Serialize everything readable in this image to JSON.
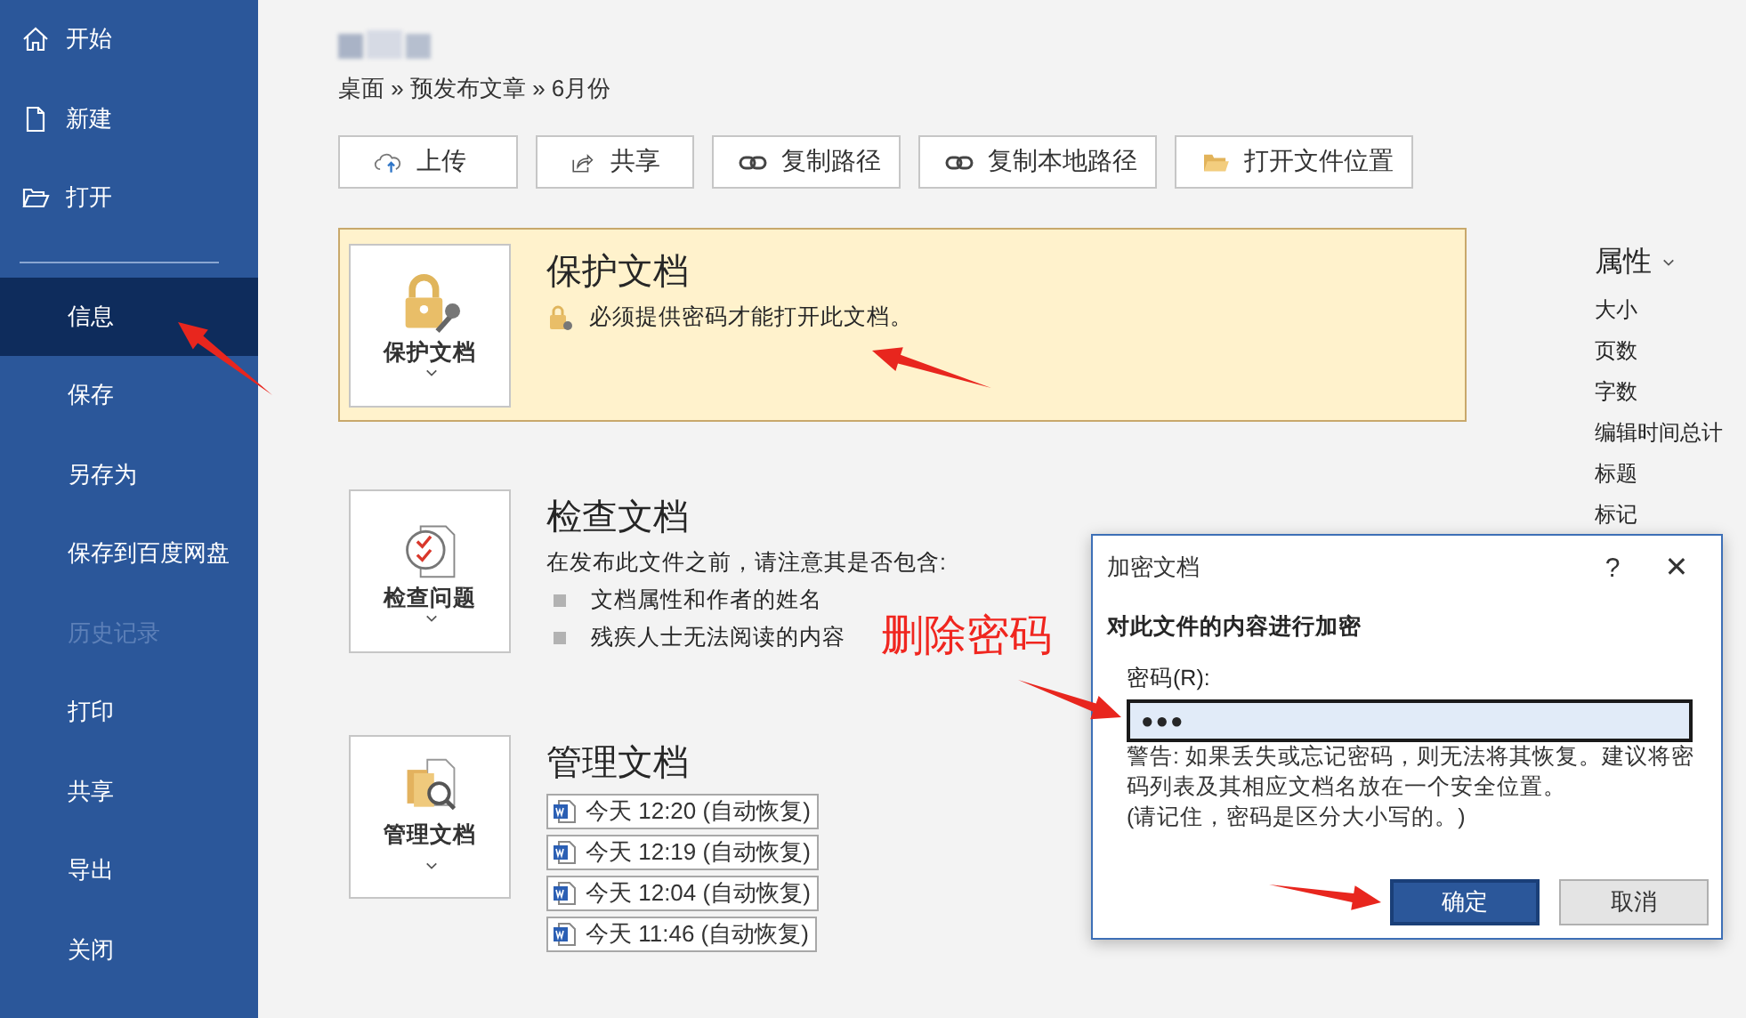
{
  "sidebar": {
    "top_items": [
      {
        "label": "开始",
        "selected": false
      },
      {
        "label": "新建",
        "selected": false
      },
      {
        "label": "打开",
        "selected": false
      }
    ],
    "items": [
      {
        "label": "信息",
        "selected": true,
        "disabled": false
      },
      {
        "label": "保存",
        "selected": false,
        "disabled": false
      },
      {
        "label": "另存为",
        "selected": false,
        "disabled": false
      },
      {
        "label": "保存到百度网盘",
        "selected": false,
        "disabled": false
      },
      {
        "label": "历史记录",
        "selected": false,
        "disabled": true
      },
      {
        "label": "打印",
        "selected": false,
        "disabled": false
      },
      {
        "label": "共享",
        "selected": false,
        "disabled": false
      },
      {
        "label": "导出",
        "selected": false,
        "disabled": false
      },
      {
        "label": "关闭",
        "selected": false,
        "disabled": false
      }
    ]
  },
  "breadcrumb": "桌面 » 预发布文章 » 6月份",
  "actions": [
    {
      "label": "上传"
    },
    {
      "label": "共享"
    },
    {
      "label": "复制路径"
    },
    {
      "label": "复制本地路径"
    },
    {
      "label": "打开文件位置"
    }
  ],
  "cards": [
    {
      "kind": "protect",
      "highlighted": true,
      "tile_label": "保护文档",
      "title": "保护文档",
      "message": "必须提供密码才能打开此文档。"
    },
    {
      "kind": "inspect",
      "highlighted": false,
      "tile_label": "检查问题",
      "title": "检查文档",
      "intro": "在发布此文件之前，请注意其是否包含:",
      "bullets": [
        "文档属性和作者的姓名",
        "残疾人士无法阅读的内容"
      ]
    },
    {
      "kind": "manage",
      "highlighted": false,
      "tile_label": "管理文档",
      "title": "管理文档",
      "versions": [
        "今天 12:20 (自动恢复)",
        "今天 12:19 (自动恢复)",
        "今天 12:04 (自动恢复)",
        "今天 11:46 (自动恢复)"
      ]
    }
  ],
  "properties": {
    "title": "属性",
    "items": [
      "大小",
      "页数",
      "字数",
      "编辑时间总计",
      "标题",
      "标记"
    ]
  },
  "dialog": {
    "title": "加密文档",
    "help": "?",
    "close": "✕",
    "heading": "对此文件的内容进行加密",
    "field_label": "密码(R):",
    "value": "●●●",
    "warning": "警告: 如果丢失或忘记密码，则无法将其恢复。建议将密码列表及其相应文档名放在一个安全位置。",
    "note": "(请记住，密码是区分大小写的。)",
    "buttons": [
      {
        "label": "确定",
        "primary": true
      },
      {
        "label": "取消",
        "primary": false
      }
    ]
  },
  "annotation": "删除密码"
}
